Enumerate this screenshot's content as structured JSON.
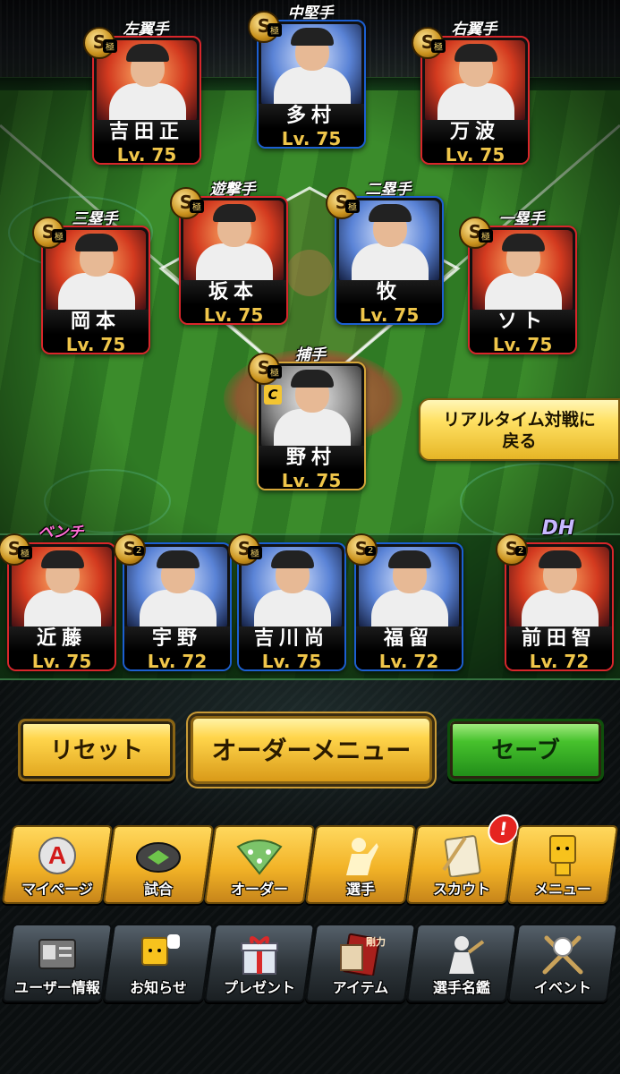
{
  "field": {
    "positions": [
      {
        "key": "lf",
        "pos": "左翼手",
        "name": "吉田正",
        "level": "Lv. 75",
        "grade": "S",
        "tag": "極",
        "frame": "red"
      },
      {
        "key": "cf",
        "pos": "中堅手",
        "name": "多村",
        "level": "Lv. 75",
        "grade": "S",
        "tag": "極",
        "frame": "blue"
      },
      {
        "key": "rf",
        "pos": "右翼手",
        "name": "万波",
        "level": "Lv. 75",
        "grade": "S",
        "tag": "極",
        "frame": "red"
      },
      {
        "key": "3b",
        "pos": "三塁手",
        "name": "岡本",
        "level": "Lv. 75",
        "grade": "S",
        "tag": "極",
        "frame": "red"
      },
      {
        "key": "ss",
        "pos": "遊撃手",
        "name": "坂本",
        "level": "Lv. 75",
        "grade": "S",
        "tag": "極",
        "frame": "red"
      },
      {
        "key": "2b",
        "pos": "二塁手",
        "name": "牧",
        "level": "Lv. 75",
        "grade": "S",
        "tag": "極",
        "frame": "blue"
      },
      {
        "key": "1b",
        "pos": "一塁手",
        "name": "ソト",
        "level": "Lv. 75",
        "grade": "S",
        "tag": "極",
        "frame": "red"
      },
      {
        "key": "c",
        "pos": "捕手",
        "name": "野村",
        "level": "Lv. 75",
        "grade": "S",
        "tag": "極",
        "frame": "gold",
        "extra": "C"
      }
    ]
  },
  "bench": {
    "label": "ベンチ",
    "dh_label": "DH",
    "players": [
      {
        "name": "近藤",
        "level": "Lv. 75",
        "grade": "S",
        "tag": "極",
        "frame": "red"
      },
      {
        "name": "宇野",
        "level": "Lv. 72",
        "grade": "S",
        "tag": "2",
        "frame": "blue"
      },
      {
        "name": "吉川尚",
        "level": "Lv. 75",
        "grade": "S",
        "tag": "極",
        "frame": "blue"
      },
      {
        "name": "福留",
        "level": "Lv. 72",
        "grade": "S",
        "tag": "2",
        "frame": "blue"
      },
      {
        "name": "前田智",
        "level": "Lv. 72",
        "grade": "S",
        "tag": "2",
        "frame": "red"
      }
    ]
  },
  "realtime_button": {
    "line1": "リアルタイム対戦に",
    "line2": "戻る"
  },
  "actions": {
    "reset": "リセット",
    "order_menu": "オーダーメニュー",
    "save": "セーブ"
  },
  "nav_main": [
    {
      "label": "マイページ",
      "icon": "a-emblem-icon"
    },
    {
      "label": "試合",
      "icon": "stadium-icon"
    },
    {
      "label": "オーダー",
      "icon": "field-order-icon"
    },
    {
      "label": "選手",
      "icon": "player-icon"
    },
    {
      "label": "スカウト",
      "icon": "scout-icon",
      "badge": "!"
    },
    {
      "label": "メニュー",
      "icon": "menu-character-icon"
    }
  ],
  "nav_sub": [
    {
      "label": "ユーザー情報",
      "icon": "profile-card-icon"
    },
    {
      "label": "お知らせ",
      "icon": "notice-character-icon"
    },
    {
      "label": "プレゼント",
      "icon": "gift-icon"
    },
    {
      "label": "アイテム",
      "icon": "item-book-icon",
      "book_text": "剛力"
    },
    {
      "label": "選手名鑑",
      "icon": "player-directory-icon"
    },
    {
      "label": "イベント",
      "icon": "baseball-bats-icon"
    }
  ],
  "colors": {
    "gold": "#f0c64a",
    "frame_red": "#d8262b",
    "frame_blue": "#1c5fd1",
    "frame_gold": "#d6a73a",
    "green_btn": "#47c22d",
    "yellow_btn": "#ffd54b"
  }
}
